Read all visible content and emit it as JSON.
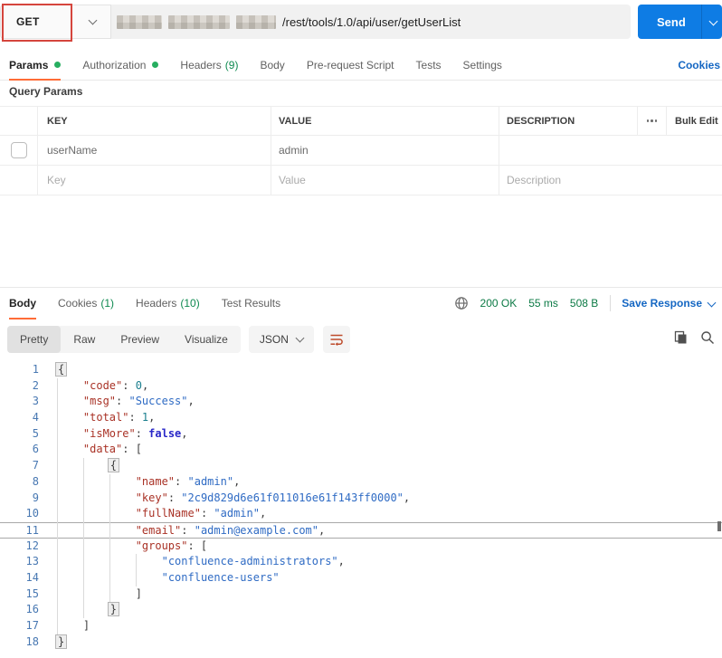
{
  "request": {
    "method": "GET",
    "url_path": "/rest/tools/1.0/api/user/getUserList",
    "send_label": "Send",
    "tabs": [
      {
        "label": "Params",
        "dot": true,
        "active": true
      },
      {
        "label": "Authorization",
        "dot": true
      },
      {
        "label": "Headers",
        "count": "(9)"
      },
      {
        "label": "Body"
      },
      {
        "label": "Pre-request Script"
      },
      {
        "label": "Tests"
      },
      {
        "label": "Settings"
      }
    ],
    "cookies_link": "Cookies",
    "query_params": {
      "title": "Query Params",
      "headers": {
        "key": "KEY",
        "value": "VALUE",
        "description": "DESCRIPTION",
        "bulk_edit": "Bulk Edit"
      },
      "rows": [
        {
          "key": "userName",
          "value": "admin",
          "description": ""
        }
      ],
      "placeholders": {
        "key": "Key",
        "value": "Value",
        "description": "Description"
      }
    }
  },
  "response": {
    "tabs": [
      {
        "label": "Body",
        "active": true
      },
      {
        "label": "Cookies",
        "count": "(1)"
      },
      {
        "label": "Headers",
        "count": "(10)"
      },
      {
        "label": "Test Results"
      }
    ],
    "status": "200 OK",
    "time": "55 ms",
    "size": "508 B",
    "save_label": "Save Response",
    "view_tabs": [
      {
        "label": "Pretty",
        "active": true
      },
      {
        "label": "Raw"
      },
      {
        "label": "Preview"
      },
      {
        "label": "Visualize"
      }
    ],
    "format_selector": "JSON",
    "body_lines": [
      {
        "n": 1,
        "i": 0,
        "t": [
          [
            "bb",
            "{"
          ]
        ]
      },
      {
        "n": 2,
        "i": 4,
        "t": [
          [
            "k",
            "\"code\""
          ],
          [
            "p",
            ": "
          ],
          [
            "num",
            "0"
          ],
          [
            "p",
            ","
          ]
        ]
      },
      {
        "n": 3,
        "i": 4,
        "t": [
          [
            "k",
            "\"msg\""
          ],
          [
            "p",
            ": "
          ],
          [
            "s",
            "\"Success\""
          ],
          [
            "p",
            ","
          ]
        ]
      },
      {
        "n": 4,
        "i": 4,
        "t": [
          [
            "k",
            "\"total\""
          ],
          [
            "p",
            ": "
          ],
          [
            "num",
            "1"
          ],
          [
            "p",
            ","
          ]
        ]
      },
      {
        "n": 5,
        "i": 4,
        "t": [
          [
            "k",
            "\"isMore\""
          ],
          [
            "p",
            ": "
          ],
          [
            "b",
            "false"
          ],
          [
            "p",
            ","
          ]
        ]
      },
      {
        "n": 6,
        "i": 4,
        "t": [
          [
            "k",
            "\"data\""
          ],
          [
            "p",
            ": ["
          ]
        ]
      },
      {
        "n": 7,
        "i": 8,
        "t": [
          [
            "bb",
            "{"
          ]
        ]
      },
      {
        "n": 8,
        "i": 12,
        "t": [
          [
            "k",
            "\"name\""
          ],
          [
            "p",
            ": "
          ],
          [
            "s",
            "\"admin\""
          ],
          [
            "p",
            ","
          ]
        ]
      },
      {
        "n": 9,
        "i": 12,
        "t": [
          [
            "k",
            "\"key\""
          ],
          [
            "p",
            ": "
          ],
          [
            "s",
            "\"2c9d829d6e61f011016e61f143ff0000\""
          ],
          [
            "p",
            ","
          ]
        ]
      },
      {
        "n": 10,
        "i": 12,
        "t": [
          [
            "k",
            "\"fullName\""
          ],
          [
            "p",
            ": "
          ],
          [
            "s",
            "\"admin\""
          ],
          [
            "p",
            ","
          ]
        ]
      },
      {
        "n": 11,
        "i": 12,
        "boxed": true,
        "t": [
          [
            "k",
            "\"email\""
          ],
          [
            "p",
            ": "
          ],
          [
            "s",
            "\"admin@example.com\""
          ],
          [
            "p",
            ","
          ]
        ]
      },
      {
        "n": 12,
        "i": 12,
        "t": [
          [
            "k",
            "\"groups\""
          ],
          [
            "p",
            ": ["
          ]
        ]
      },
      {
        "n": 13,
        "i": 16,
        "t": [
          [
            "s",
            "\"confluence-administrators\""
          ],
          [
            "p",
            ","
          ]
        ]
      },
      {
        "n": 14,
        "i": 16,
        "t": [
          [
            "s",
            "\"confluence-users\""
          ]
        ]
      },
      {
        "n": 15,
        "i": 12,
        "t": [
          [
            "p",
            "]"
          ]
        ]
      },
      {
        "n": 16,
        "i": 8,
        "t": [
          [
            "bb",
            "}"
          ]
        ]
      },
      {
        "n": 17,
        "i": 4,
        "t": [
          [
            "p",
            "]"
          ]
        ]
      },
      {
        "n": 18,
        "i": 0,
        "t": [
          [
            "bb",
            "}"
          ]
        ]
      }
    ]
  },
  "icons": {
    "globe": "globe-icon",
    "copy": "copy-icon",
    "search": "search-icon",
    "text_wrap": "text-wrap-icon",
    "more_options": "more-options-icon",
    "chevron": "chevron-down-icon"
  },
  "colors": {
    "accent_orange": "#FF6C37",
    "send_blue": "#0E7CE4",
    "link_blue": "#1567C3",
    "green_dot": "#27AE60",
    "green_text": "#0C7A45",
    "annotation_red": "#D5453D",
    "json_key": "#A93226",
    "json_string": "#2F6BC4",
    "json_number": "#1A7F8E",
    "json_boolean": "#2A28C8",
    "line_number_blue": "#4878B2"
  }
}
